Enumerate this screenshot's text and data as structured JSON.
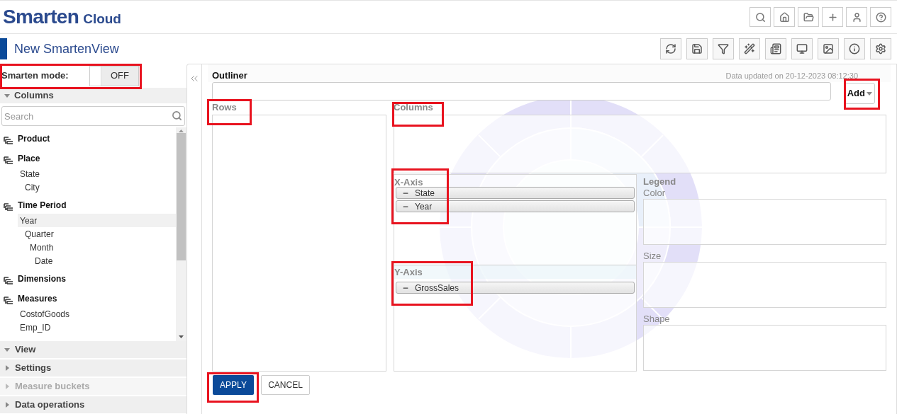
{
  "header": {
    "brand": "Smarten",
    "brand_suffix": "Cloud"
  },
  "view_title": "New SmartenView",
  "sidebar": {
    "smarten_mode": {
      "label": "Smarten mode:",
      "value": "OFF",
      "on": false
    },
    "columns_section": {
      "label": "Columns",
      "expanded": true
    },
    "search": {
      "placeholder": "Search"
    },
    "tree": [
      {
        "label": "Product",
        "selected": false
      },
      {
        "label": "Place",
        "selected": false,
        "children": [
          {
            "label": "State",
            "selected": false,
            "children": [
              {
                "label": "City",
                "selected": false
              }
            ]
          }
        ]
      },
      {
        "label": "Time Period",
        "selected": false,
        "children": [
          {
            "label": "Year",
            "selected": true,
            "children": [
              {
                "label": "Quarter",
                "selected": false,
                "children": [
                  {
                    "label": "Month",
                    "selected": false,
                    "children": [
                      {
                        "label": "Date",
                        "selected": false
                      }
                    ]
                  }
                ]
              }
            ]
          }
        ]
      },
      {
        "label": "Dimensions",
        "selected": false
      },
      {
        "label": "Measures",
        "selected": false,
        "children": [
          {
            "label": "CostofGoods",
            "selected": false
          },
          {
            "label": "Emp_ID",
            "selected": false
          }
        ]
      }
    ],
    "sections": [
      {
        "label": "View",
        "expanded": true,
        "disabled": false
      },
      {
        "label": "Settings",
        "expanded": false,
        "disabled": false
      },
      {
        "label": "Measure buckets",
        "expanded": false,
        "disabled": true
      },
      {
        "label": "Data operations",
        "expanded": false,
        "disabled": false
      }
    ]
  },
  "outliner": {
    "title": "Outliner",
    "data_updated": "Data updated on  20-12-2023 08:12:30",
    "add_button": "Add"
  },
  "rows": {
    "label": "Rows"
  },
  "columns": {
    "label": "Columns"
  },
  "x_axis": {
    "label": "X-Axis",
    "items": [
      "State",
      "Year"
    ]
  },
  "y_axis": {
    "label": "Y-Axis",
    "items": [
      "GrossSales"
    ]
  },
  "legend": {
    "label": "Legend",
    "fields": [
      "Color",
      "Size",
      "Shape"
    ]
  },
  "buttons": {
    "apply": "APPLY",
    "cancel": "CANCEL"
  }
}
